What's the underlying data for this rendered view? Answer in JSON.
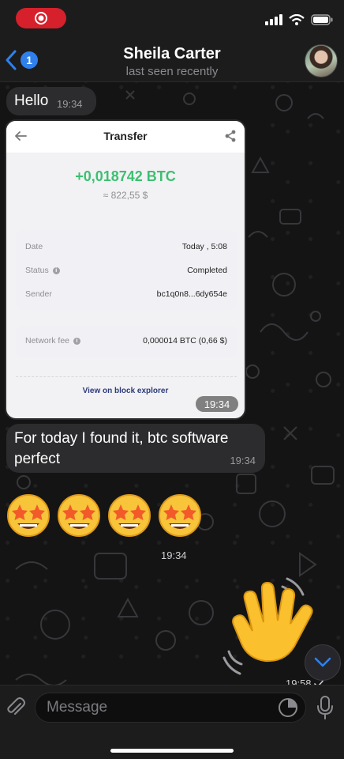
{
  "header": {
    "contact_name": "Sheila Carter",
    "status": "last seen recently",
    "unread_badge": "1"
  },
  "messages": {
    "hello": {
      "text": "Hello",
      "time": "19:34"
    },
    "screenshot": {
      "title": "Transfer",
      "amount": "+0,018742 BTC",
      "fiat": "≈ 822,55 $",
      "rows": [
        {
          "label": "Date",
          "value": "Today , 5:08"
        },
        {
          "label": "Status",
          "value": "Completed"
        },
        {
          "label": "Sender",
          "value": "bc1q0n8...6dy654e"
        }
      ],
      "fee": {
        "label": "Network fee",
        "value": "0,000014 BTC (0,66 $)"
      },
      "explorer_link": "View on block explorer",
      "time": "19:34"
    },
    "found": {
      "text": "For today I found it, btc software perfect",
      "time": "19:34"
    },
    "emojis": {
      "glyph": "🤩",
      "count": 4,
      "time": "19:34"
    },
    "wave": {
      "glyph": "👋",
      "time": "19:58"
    }
  },
  "input": {
    "placeholder": "Message"
  },
  "colors": {
    "accent": "#2f80ed",
    "btc_green": "#3dbf72",
    "record": "#d6202b",
    "bubble": "#2c2c2e"
  }
}
